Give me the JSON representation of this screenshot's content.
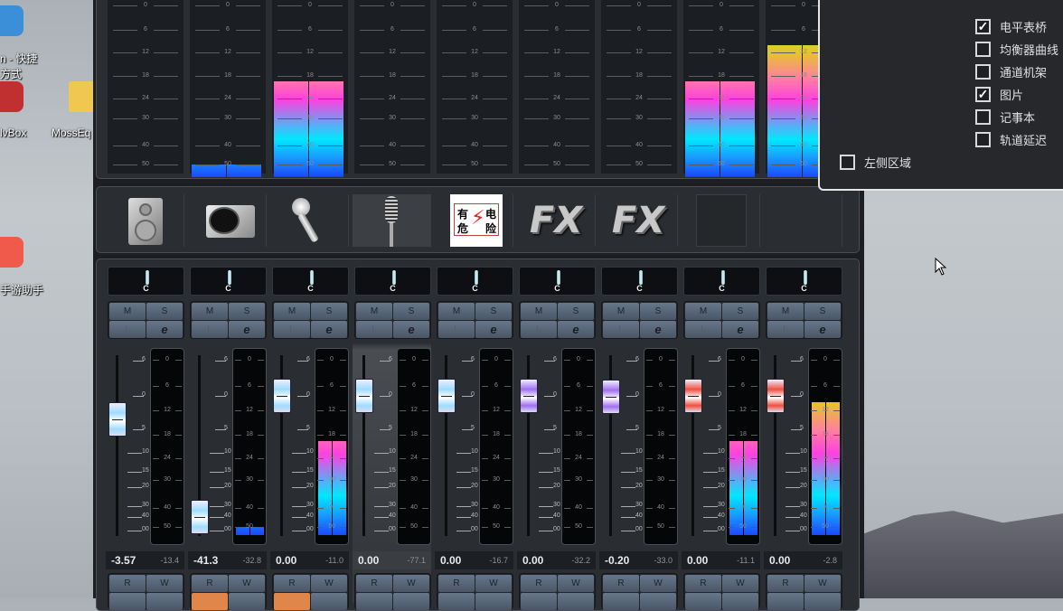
{
  "desktop": {
    "icons": [
      {
        "label1": "n - 快捷",
        "label2": "方式"
      },
      {
        "label1": "lvBox"
      },
      {
        "label1": "MossEq"
      },
      {
        "label1": "手游助手"
      }
    ]
  },
  "picture_row": [
    {
      "icon": "speaker-icon"
    },
    {
      "icon": "turntable-icon"
    },
    {
      "icon": "microphone-icon"
    },
    {
      "icon": "vintage-microphone-icon"
    },
    {
      "icon": "danger-sign-icon",
      "text": [
        "有",
        "危",
        "电",
        "险"
      ]
    },
    {
      "icon": "fx-icon",
      "text": "FX"
    },
    {
      "icon": "fx-icon",
      "text": "FX"
    },
    {
      "icon": "empty-picture"
    },
    {
      "icon": "none"
    }
  ],
  "top_meter_scale": [
    "0",
    "6",
    "12",
    "18",
    "24",
    "30",
    "40",
    "50"
  ],
  "fader_scale": [
    "6",
    "0",
    "5",
    "10",
    "15",
    "20",
    "30",
    "40",
    "00"
  ],
  "meter_scale": [
    "0",
    "6",
    "12",
    "18",
    "24",
    "30",
    "40",
    "50"
  ],
  "selected_channel": 3,
  "channels": [
    {
      "pan": "C",
      "mute": "M",
      "solo": "S",
      "listen": "L",
      "edit": "e",
      "fader_db": -3.57,
      "volume": "-3.57",
      "peak": "-13.4",
      "level_db": null,
      "fader_color": "#9fdcff",
      "read": "R",
      "write": "W",
      "read_active": false
    },
    {
      "pan": "C",
      "mute": "M",
      "solo": "S",
      "listen": "L",
      "edit": "e",
      "fader_db": -41.3,
      "volume": "-41.3",
      "peak": "-32.8",
      "level_db": 50,
      "fader_color": "#9fdcff",
      "read": "R",
      "write": "W",
      "read_active": true
    },
    {
      "pan": "C",
      "mute": "M",
      "solo": "S",
      "listen": "L",
      "edit": "e",
      "fader_db": 0,
      "volume": "0.00",
      "peak": "-11.0",
      "level_db": 19.5,
      "fader_color": "#9fdcff",
      "read": "R",
      "write": "W",
      "read_active": true
    },
    {
      "pan": "C",
      "mute": "M",
      "solo": "S",
      "listen": "L",
      "edit": "e",
      "fader_db": 0,
      "volume": "0.00",
      "peak": "-77.1",
      "level_db": null,
      "fader_color": "#9fdcff",
      "read": "R",
      "write": "W",
      "read_active": false
    },
    {
      "pan": "C",
      "mute": "M",
      "solo": "S",
      "listen": "L",
      "edit": "e",
      "fader_db": 0,
      "volume": "0.00",
      "peak": "-16.7",
      "level_db": null,
      "fader_color": "#9fdcff",
      "read": "R",
      "write": "W",
      "read_active": false
    },
    {
      "pan": "C",
      "mute": "M",
      "solo": "S",
      "listen": "L",
      "edit": "e",
      "fader_db": 0,
      "volume": "0.00",
      "peak": "-32.2",
      "level_db": null,
      "fader_color": "#a070f0",
      "read": "R",
      "write": "W",
      "read_active": false
    },
    {
      "pan": "C",
      "mute": "M",
      "solo": "S",
      "listen": "L",
      "edit": "e",
      "fader_db": -0.2,
      "volume": "-0.20",
      "peak": "-33.0",
      "level_db": null,
      "fader_color": "#a070f0",
      "read": "R",
      "write": "W",
      "read_active": false
    },
    {
      "pan": "C",
      "mute": "M",
      "solo": "S",
      "listen": "L",
      "edit": "e",
      "fader_db": 0,
      "volume": "0.00",
      "peak": "-11.1",
      "level_db": 19.5,
      "fader_color": "#f05040",
      "read": "R",
      "write": "W",
      "read_active": false
    },
    {
      "pan": "C",
      "mute": "M",
      "solo": "S",
      "listen": "L",
      "edit": "e",
      "fader_db": 0,
      "volume": "0.00",
      "peak": "-2.8",
      "level_db": 10,
      "fader_color": "#f05040",
      "read": "R",
      "write": "W",
      "read_active": false
    }
  ],
  "popup": {
    "options": [
      {
        "label": "电平表桥",
        "checked": true
      },
      {
        "label": "均衡器曲线",
        "checked": false
      },
      {
        "label": "通道机架",
        "checked": false
      },
      {
        "label": "图片",
        "checked": true
      },
      {
        "label": "记事本",
        "checked": false
      },
      {
        "label": "轨道延迟",
        "checked": false
      }
    ],
    "left_zone": {
      "label": "左侧区域",
      "checked": false
    }
  },
  "colors": {
    "read_active": "#e0864a",
    "selected_bg": "#3c3f43"
  }
}
